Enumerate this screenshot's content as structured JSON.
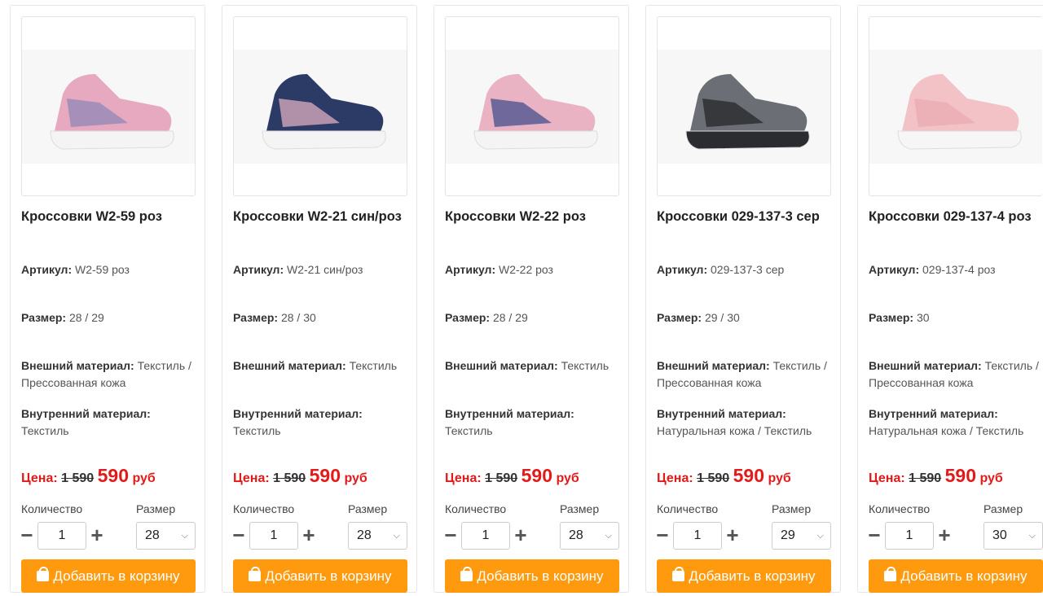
{
  "labels": {
    "article": "Артикул:",
    "size": "Размер:",
    "outer": "Внешний материал:",
    "inner": "Внутренний материал:",
    "price": "Цена:",
    "currency": "руб",
    "quantity": "Количество",
    "size_select": "Размер",
    "add_to_cart": "Добавить в корзину"
  },
  "colors": {
    "accent": "#ff9a0e",
    "price": "#e31a1a"
  },
  "products": [
    {
      "title": "Кроссовки W2-59 роз",
      "article": "W2-59 роз",
      "size": "28 / 29",
      "outer": "Текстиль / Прессованная кожа",
      "inner": "Текстиль",
      "old_price": "1 590",
      "price": "590",
      "qty": "1",
      "selected_size": "28",
      "shoe_colors": {
        "upper": "#e6a9bf",
        "accent": "#8a86b8",
        "sole": "#f4f4f4"
      }
    },
    {
      "title": "Кроссовки W2-21 син/роз",
      "article": "W2-21 син/роз",
      "size": "28 / 30",
      "outer": "Текстиль",
      "inner": "Текстиль",
      "old_price": "1 590",
      "price": "590",
      "qty": "1",
      "selected_size": "28",
      "shoe_colors": {
        "upper": "#2c3a66",
        "accent": "#e9b6c7",
        "sole": "#f4f4f4"
      }
    },
    {
      "title": "Кроссовки W2-22 роз",
      "article": "W2-22 роз",
      "size": "28 / 29",
      "outer": "Текстиль",
      "inner": "Текстиль",
      "old_price": "1 590",
      "price": "590",
      "qty": "1",
      "selected_size": "28",
      "shoe_colors": {
        "upper": "#eab3c4",
        "accent": "#3a4a8a",
        "sole": "#f4f4f4"
      }
    },
    {
      "title": "Кроссовки 029-137-3 сер",
      "article": "029-137-3 сер",
      "size": "29 / 30",
      "outer": "Текстиль / Прессованная кожа",
      "inner": "Натуральная кожа / Текстиль",
      "old_price": "1 590",
      "price": "590",
      "qty": "1",
      "selected_size": "29",
      "shoe_colors": {
        "upper": "#6b6e74",
        "accent": "#1f2124",
        "sole": "#2a2c30"
      }
    },
    {
      "title": "Кроссовки 029-137-4 роз",
      "article": "029-137-4 роз",
      "size": "30",
      "outer": "Текстиль / Прессованная кожа",
      "inner": "Натуральная кожа / Текстиль",
      "old_price": "1 590",
      "price": "590",
      "qty": "1",
      "selected_size": "30",
      "shoe_colors": {
        "upper": "#f2c2c6",
        "accent": "#e9a8b0",
        "sole": "#f6f6f6"
      }
    }
  ]
}
